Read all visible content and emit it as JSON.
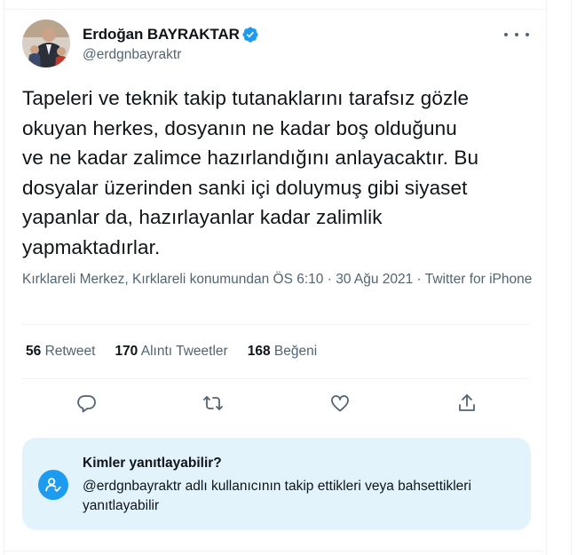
{
  "tweet": {
    "author_name": "Erdoğan BAYRAKTAR",
    "handle": "@erdgnbayraktr",
    "text": "Tapeleri ve teknik takip tutanaklarını tarafsız gözle\nokuyan herkes, dosyanın ne kadar boş olduğunu\nve ne kadar zalimce hazırlandığını anlayacaktır. Bu\ndosyalar üzerinden sanki içi doluymuş gibi siyaset\nyapanlar da, hazırlayanlar kadar zalimlik\nyapmaktadırlar.",
    "meta": "Kırklareli Merkez, Kırklareli konumundan ÖS 6:10 · 30 Ağu 2021 · Twitter for iPhone"
  },
  "stats": {
    "retweets_count": "56",
    "retweets_label": "Retweet",
    "quotes_count": "170",
    "quotes_label": "Alıntı Tweetler",
    "likes_count": "168",
    "likes_label": "Beğeni"
  },
  "reply_info": {
    "title": "Kimler yanıtlayabilir?",
    "description": "@erdgnbayraktr adlı kullanıcının takip ettikleri veya bahsettikleri yanıtlayabilir"
  },
  "icons": {
    "verified": "verified-badge-icon",
    "more": "more-icon",
    "reply": "reply-icon",
    "retweet": "retweet-icon",
    "like": "heart-icon",
    "share": "share-icon",
    "reply_restriction": "mention-person-icon"
  },
  "colors": {
    "accent": "#1d9bf0",
    "secondary_text": "#536471",
    "reply_box_bg": "#e3f3fc"
  }
}
